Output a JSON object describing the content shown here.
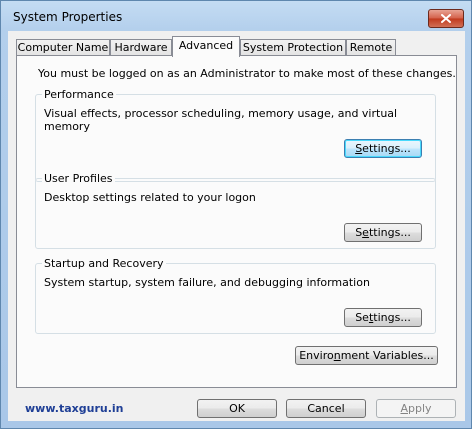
{
  "window": {
    "title": "System Properties"
  },
  "tabs": [
    {
      "label": "Computer Name",
      "active": false
    },
    {
      "label": "Hardware",
      "active": false
    },
    {
      "label": "Advanced",
      "active": true
    },
    {
      "label": "System Protection",
      "active": false
    },
    {
      "label": "Remote",
      "active": false
    }
  ],
  "advanced": {
    "note": "You must be logged on as an Administrator to make most of these changes.",
    "performance": {
      "title": "Performance",
      "description": "Visual effects, processor scheduling, memory usage, and virtual memory",
      "settings_prefix": "",
      "settings_mnemonic": "S",
      "settings_suffix": "ettings..."
    },
    "user_profiles": {
      "title": "User Profiles",
      "description": "Desktop settings related to your logon",
      "settings_prefix": "S",
      "settings_mnemonic": "e",
      "settings_suffix": "ttings..."
    },
    "startup_recovery": {
      "title": "Startup and Recovery",
      "description": "System startup, system failure, and debugging information",
      "settings_prefix": "Se",
      "settings_mnemonic": "t",
      "settings_suffix": "tings..."
    },
    "env_vars": {
      "prefix": "Enviro",
      "mnemonic": "n",
      "suffix": "ment Variables..."
    }
  },
  "footer": {
    "brand": "www.taxguru.in",
    "ok_label": "OK",
    "cancel_label": "Cancel",
    "apply_prefix": "",
    "apply_mnemonic": "A",
    "apply_suffix": "pply"
  },
  "icons": {
    "close": "close-icon"
  },
  "colors": {
    "close_button": "#c1391d",
    "brand_text": "#1f3f96",
    "default_button_border": "#3c7fb1"
  }
}
